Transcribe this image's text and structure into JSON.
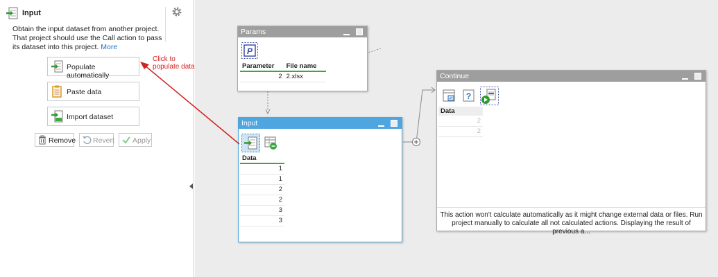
{
  "panel": {
    "title": "Input",
    "icon": "input-arrow-icon",
    "settings_icon": "gear-icon",
    "description": "Obtain the input dataset from another project. That project should use the Call action to pass its dataset into this project.",
    "more_label": "More",
    "buttons": {
      "populate": "Populate automatically",
      "paste": "Paste data",
      "import": "Import dataset"
    },
    "actions": {
      "remove": "Remove",
      "revert": "Revert",
      "apply": "Apply"
    }
  },
  "annotation": {
    "line1": "Click to",
    "line2": "populate data"
  },
  "nodes": {
    "params": {
      "title": "Params",
      "columns": [
        "Parameter",
        "File name"
      ],
      "rows": [
        [
          "2",
          "2.xlsx"
        ]
      ]
    },
    "input": {
      "title": "Input",
      "column": "Data",
      "rows": [
        "1",
        "1",
        "2",
        "2",
        "3",
        "3"
      ]
    },
    "continue": {
      "title": "Continue",
      "column": "Data",
      "rows": [
        "2",
        "2"
      ],
      "message": "This action won't calculate automatically as it might change external data or files. Run project manually to calculate all not calculated actions. Displaying the result of previous a..."
    }
  },
  "colors": {
    "accent": "#4da6e0",
    "annotation": "#d42020",
    "header_underline": "#3aa83a"
  }
}
